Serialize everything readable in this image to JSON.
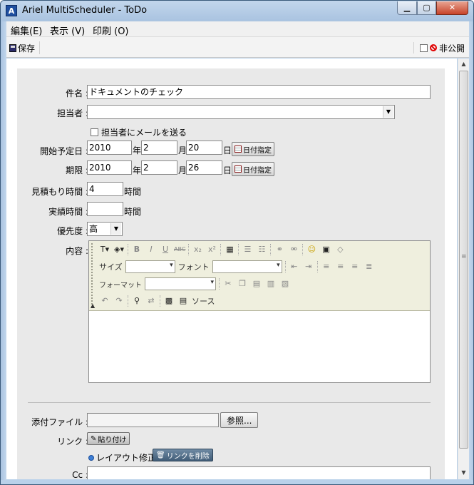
{
  "window": {
    "title": "Ariel MultiScheduler - ToDo",
    "app_icon": "A"
  },
  "menu": {
    "edit": "編集(E)",
    "view": "表示 (V)",
    "print": "印刷 (O)"
  },
  "toolbar": {
    "save": "保存",
    "private": "非公開"
  },
  "form": {
    "subject_label": "件名 :",
    "subject_value": "ドキュメントのチェック",
    "assignee_label": "担当者 :",
    "assignee_value": "",
    "notify_label": "担当者にメールを送る",
    "start_label": "開始予定日 :",
    "start_year": "2010",
    "start_month": "2",
    "start_day": "20",
    "deadline_label": "期限 :",
    "deadline_year": "2010",
    "deadline_month": "2",
    "deadline_day": "26",
    "year_unit": "年",
    "month_unit": "月",
    "day_unit": "日",
    "date_button": "日付指定",
    "estimate_label": "見積もり時間 :",
    "estimate_value": "4",
    "actual_label": "実績時間 :",
    "actual_value": "",
    "hours_unit": "時間",
    "priority_label": "優先度 :",
    "priority_value": "高",
    "content_label": "内容 :",
    "attachment_label": "添付ファイル :",
    "browse_button": "参照...",
    "link_label": "リンク :",
    "paste_button": "貼り付け",
    "layout_fix": "レイアウト修正",
    "delete_link_button": "リンクを削除",
    "cc_label": "Cc :"
  },
  "editor": {
    "size_label": "サイズ",
    "font_label": "フォント",
    "format_label": "フォーマット",
    "source_label": "ソース"
  },
  "colors": {
    "titlebar": "#b9d1ea",
    "close": "#c7432a",
    "panel": "#e9e9e9",
    "editor_toolbar": "#efefde"
  }
}
